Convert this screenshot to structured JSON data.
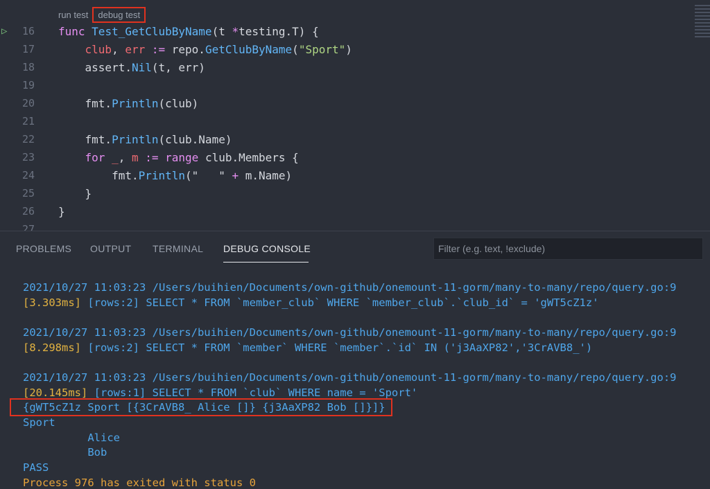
{
  "codelens": {
    "run_test": "run test",
    "debug_test": "debug test"
  },
  "code_lines": [
    {
      "num": "16",
      "tokens": [
        {
          "t": "func ",
          "c": "kw"
        },
        {
          "t": "Test_GetClubByName",
          "c": "fn"
        },
        {
          "t": "(t ",
          "c": "plain"
        },
        {
          "t": "*",
          "c": "kw"
        },
        {
          "t": "testing.T) {",
          "c": "plain"
        }
      ]
    },
    {
      "num": "17",
      "tokens": [
        {
          "t": "    club",
          "c": "var"
        },
        {
          "t": ", ",
          "c": "plain"
        },
        {
          "t": "err",
          "c": "var"
        },
        {
          "t": " := ",
          "c": "kw"
        },
        {
          "t": "repo.",
          "c": "plain"
        },
        {
          "t": "GetClubByName",
          "c": "fn"
        },
        {
          "t": "(",
          "c": "plain"
        },
        {
          "t": "\"Sport\"",
          "c": "str"
        },
        {
          "t": ")",
          "c": "plain"
        }
      ]
    },
    {
      "num": "18",
      "tokens": [
        {
          "t": "    assert.",
          "c": "plain"
        },
        {
          "t": "Nil",
          "c": "fn"
        },
        {
          "t": "(t, err)",
          "c": "plain"
        }
      ]
    },
    {
      "num": "19",
      "tokens": []
    },
    {
      "num": "20",
      "tokens": [
        {
          "t": "    fmt.",
          "c": "plain"
        },
        {
          "t": "Println",
          "c": "fn"
        },
        {
          "t": "(club)",
          "c": "plain"
        }
      ]
    },
    {
      "num": "21",
      "tokens": []
    },
    {
      "num": "22",
      "tokens": [
        {
          "t": "    fmt.",
          "c": "plain"
        },
        {
          "t": "Println",
          "c": "fn"
        },
        {
          "t": "(club.Name)",
          "c": "plain"
        }
      ]
    },
    {
      "num": "23",
      "tokens": [
        {
          "t": "    for ",
          "c": "kw"
        },
        {
          "t": "_",
          "c": "var"
        },
        {
          "t": ", ",
          "c": "plain"
        },
        {
          "t": "m",
          "c": "var"
        },
        {
          "t": " := ",
          "c": "kw"
        },
        {
          "t": "range ",
          "c": "kw"
        },
        {
          "t": "club.Members {",
          "c": "plain"
        }
      ]
    },
    {
      "num": "24",
      "tokens": [
        {
          "t": "        fmt.",
          "c": "plain"
        },
        {
          "t": "Println",
          "c": "fn"
        },
        {
          "t": "(\"   \" ",
          "c": "plain"
        },
        {
          "t": "+",
          "c": "kw"
        },
        {
          "t": " m.Name)",
          "c": "plain"
        }
      ]
    },
    {
      "num": "25",
      "tokens": [
        {
          "t": "    }",
          "c": "plain"
        }
      ]
    },
    {
      "num": "26",
      "tokens": [
        {
          "t": "}",
          "c": "plain"
        }
      ]
    },
    {
      "num": "27",
      "tokens": []
    }
  ],
  "panel": {
    "tabs": [
      "PROBLEMS",
      "OUTPUT",
      "TERMINAL",
      "DEBUG CONSOLE"
    ],
    "active_tab": "DEBUG CONSOLE",
    "filter_placeholder": "Filter (e.g. text, !exclude)"
  },
  "console_lines": [
    {
      "text": "2021/10/27 11:03:23 /Users/buihien/Documents/own-github/onemount-11-gorm/many-to-many/repo/query.go:9",
      "color": "blue"
    },
    {
      "text": "[3.303ms] [rows:2] SELECT * FROM `member_club` WHERE `member_club`.`club_id` = 'gWT5cZ1z'",
      "color": "mixed",
      "parts": [
        {
          "t": "[3.303ms] ",
          "c": "gold"
        },
        {
          "t": "[rows:2]",
          "c": "blue"
        },
        {
          "t": " SELECT * FROM `member_club` WHERE `member_club`.`club_id` = 'gWT5cZ1z'",
          "c": "blue"
        }
      ]
    },
    {
      "text": "",
      "color": "blue"
    },
    {
      "text": "2021/10/27 11:03:23 /Users/buihien/Documents/own-github/onemount-11-gorm/many-to-many/repo/query.go:9",
      "color": "blue"
    },
    {
      "text": "[8.298ms] [rows:2] SELECT * FROM `member` WHERE `member`.`id` IN ('j3AaXP82','3CrAVB8_')",
      "color": "mixed",
      "parts": [
        {
          "t": "[8.298ms] ",
          "c": "gold"
        },
        {
          "t": "[rows:2]",
          "c": "blue"
        },
        {
          "t": " SELECT * FROM `member` WHERE `member`.`id` IN ('j3AaXP82','3CrAVB8_')",
          "c": "blue"
        }
      ]
    },
    {
      "text": "",
      "color": "blue"
    },
    {
      "text": "2021/10/27 11:03:23 /Users/buihien/Documents/own-github/onemount-11-gorm/many-to-many/repo/query.go:9",
      "color": "blue"
    },
    {
      "text": "[20.145ms] [rows:1] SELECT * FROM `club` WHERE name = 'Sport'",
      "color": "mixed",
      "parts": [
        {
          "t": "[20.145ms] ",
          "c": "gold"
        },
        {
          "t": "[rows:1]",
          "c": "blue"
        },
        {
          "t": " SELECT * FROM `club` WHERE name = 'Sport'",
          "c": "blue"
        }
      ]
    },
    {
      "text": "{gWT5cZ1z Sport [{3CrAVB8_ Alice []} {j3AaXP82 Bob []}]}",
      "color": "blue"
    },
    {
      "text": "Sport",
      "color": "blue"
    },
    {
      "text": "          Alice",
      "color": "blue"
    },
    {
      "text": "          Bob",
      "color": "blue"
    },
    {
      "text": "PASS",
      "color": "blue"
    },
    {
      "text": "Process 976 has exited with status 0",
      "color": "orange"
    }
  ],
  "colors": {
    "blue": "#4fa6ea",
    "gold": "#e3b341",
    "orange": "#e6a33a",
    "highlight": "#e0321f"
  }
}
